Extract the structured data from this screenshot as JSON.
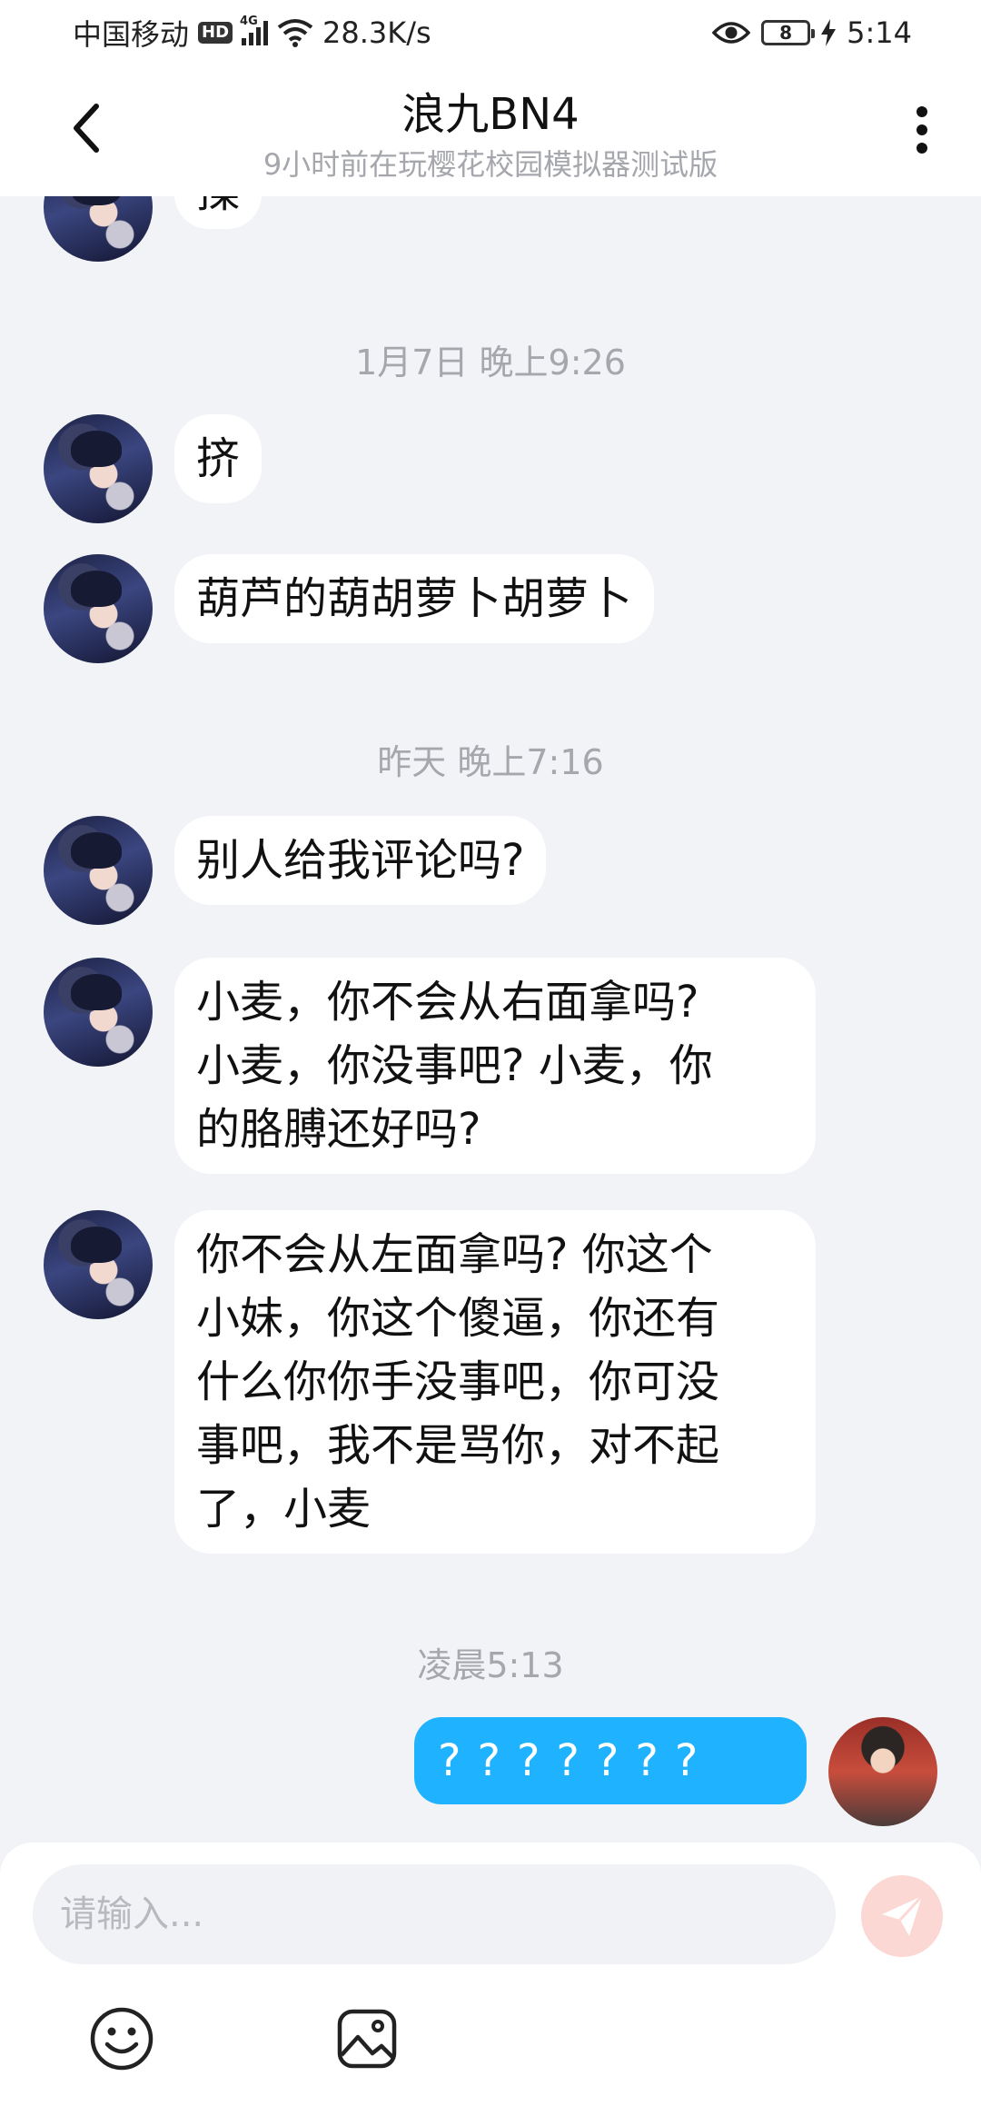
{
  "status_bar": {
    "carrier": "中国移动",
    "hd_badge": "HD",
    "network_type": "4G",
    "speed": "28.3K/s",
    "battery_level": "8",
    "time": "5:14"
  },
  "header": {
    "title": "浪九BN4",
    "subtitle": "9小时前在玩樱花校园模拟器测试版"
  },
  "messages": {
    "partial": {
      "text": "揉"
    },
    "ts1": "1月7日 晚上9:26",
    "m1": "挤",
    "m2": "葫芦的葫胡萝卜胡萝卜",
    "ts2": "昨天 晚上7:16",
    "m3": "别人给我评论吗?",
    "m4": [
      "小麦，你不会从右面拿吗?",
      "小麦，你没事吧? 小麦，你",
      "的胳膊还好吗?"
    ],
    "m5": [
      "你不会从左面拿吗? 你这个",
      "小妹，你这个傻逼，你还有",
      "什么你你手没事吧，你可没",
      "事吧，我不是骂你，对不起",
      "了，小麦"
    ],
    "ts3": "凌晨5:13",
    "me1": "???????"
  },
  "composer": {
    "placeholder": "请输入..."
  },
  "colors": {
    "accent": "#1fb3ff",
    "send_disabled": "#fbd8d3",
    "background": "#f2f3f7"
  }
}
